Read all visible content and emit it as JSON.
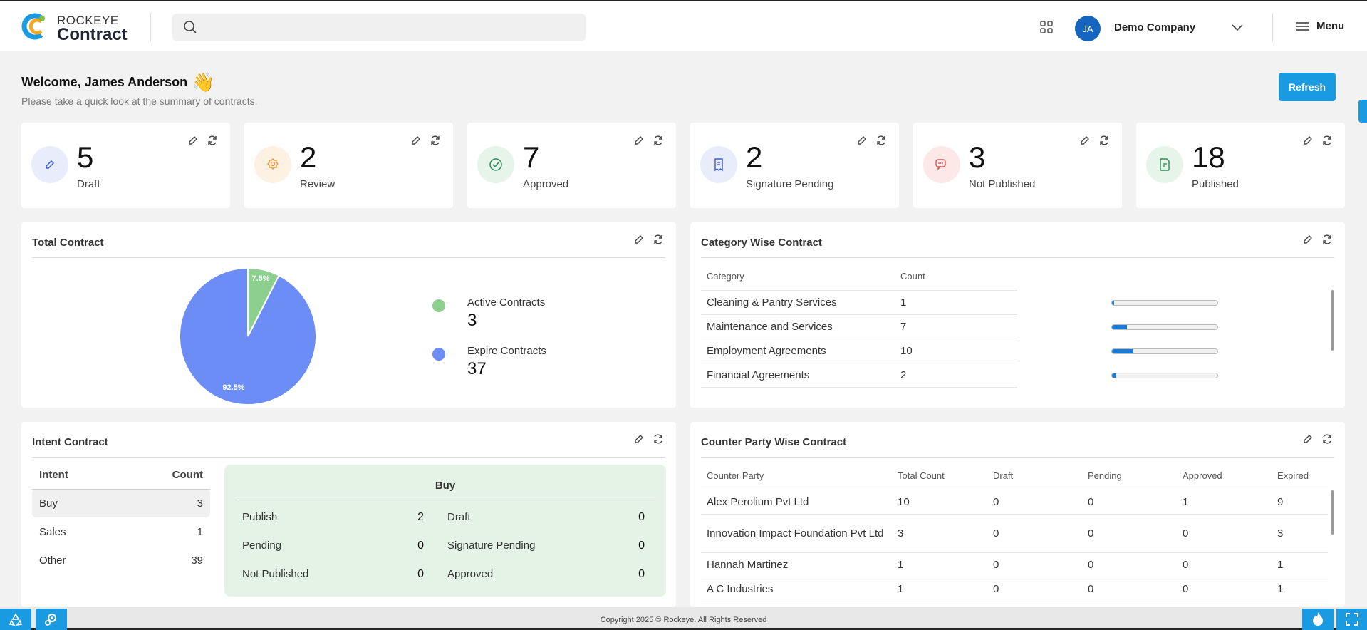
{
  "brand": {
    "name_top": "ROCKEYE",
    "name_bottom": "Contract"
  },
  "search": {
    "placeholder": ""
  },
  "header": {
    "avatar_initials": "JA",
    "company": "Demo Company",
    "menu_label": "Menu"
  },
  "welcome": {
    "title": "Welcome, James Anderson",
    "emoji": "👋",
    "subtitle": "Please take a quick look at the summary of contracts."
  },
  "refresh_label": "Refresh",
  "stats": [
    {
      "value": "5",
      "label": "Draft",
      "icon": "pencil-icon",
      "bg": "#e8ecfb",
      "color": "#3b5bdb"
    },
    {
      "value": "2",
      "label": "Review",
      "icon": "badge-icon",
      "bg": "#fdf1e4",
      "color": "#e8943a"
    },
    {
      "value": "7",
      "label": "Approved",
      "icon": "check-circle-icon",
      "bg": "#e6f4ea",
      "color": "#2e8b57"
    },
    {
      "value": "2",
      "label": "Signature Pending",
      "icon": "receipt-icon",
      "bg": "#e8ecfb",
      "color": "#3b5bdb"
    },
    {
      "value": "3",
      "label": "Not Published",
      "icon": "chat-icon",
      "bg": "#fde8e8",
      "color": "#d9534f"
    },
    {
      "value": "18",
      "label": "Published",
      "icon": "document-icon",
      "bg": "#e6f4ea",
      "color": "#2e8b57"
    }
  ],
  "total_contract": {
    "title": "Total Contract",
    "legend": [
      {
        "label": "Active Contracts",
        "value": "3",
        "color": "#8ccf8f"
      },
      {
        "label": "Expire Contracts",
        "value": "37",
        "color": "#6b8df5"
      }
    ]
  },
  "chart_data": {
    "type": "pie",
    "title": "Total Contract",
    "slices": [
      {
        "label": "Active Contracts",
        "value": 3,
        "percent_label": "7.5%",
        "color": "#8ccf8f"
      },
      {
        "label": "Expire Contracts",
        "value": 37,
        "percent_label": "92.5%",
        "color": "#6b8df5"
      }
    ]
  },
  "category": {
    "title": "Category Wise Contract",
    "headers": [
      "Category",
      "Count"
    ],
    "rows": [
      {
        "name": "Cleaning & Pantry Services",
        "count": "1",
        "fill": 0.02
      },
      {
        "name": "Maintenance and Services",
        "count": "7",
        "fill": 0.14
      },
      {
        "name": "Employment Agreements",
        "count": "10",
        "fill": 0.2
      },
      {
        "name": "Financial Agreements",
        "count": "2",
        "fill": 0.04
      }
    ]
  },
  "intent": {
    "title": "Intent Contract",
    "headers": [
      "Intent",
      "Count"
    ],
    "rows": [
      {
        "name": "Buy",
        "count": "3"
      },
      {
        "name": "Sales",
        "count": "1"
      },
      {
        "name": "Other",
        "count": "39"
      }
    ],
    "detail": {
      "title": "Buy",
      "left": [
        {
          "label": "Publish",
          "value": "2"
        },
        {
          "label": "Pending",
          "value": "0"
        },
        {
          "label": "Not Published",
          "value": "0"
        }
      ],
      "right": [
        {
          "label": "Draft",
          "value": "0"
        },
        {
          "label": "Signature Pending",
          "value": "0"
        },
        {
          "label": "Approved",
          "value": "0"
        }
      ]
    }
  },
  "counterparty": {
    "title": "Counter Party Wise Contract",
    "headers": [
      "Counter Party",
      "Total Count",
      "Draft",
      "Pending",
      "Approved",
      "Expired"
    ],
    "rows": [
      [
        "Alex Perolium Pvt Ltd",
        "10",
        "0",
        "0",
        "1",
        "9"
      ],
      [
        "Innovation Impact Foundation Pvt Ltd",
        "3",
        "0",
        "0",
        "0",
        "3"
      ],
      [
        "Hannah Martinez",
        "1",
        "0",
        "0",
        "0",
        "1"
      ],
      [
        "A C Industries",
        "1",
        "0",
        "0",
        "0",
        "1"
      ]
    ]
  },
  "footer": {
    "copyright": "Copyright 2025 © Rockeye. All Rights Reserved"
  }
}
